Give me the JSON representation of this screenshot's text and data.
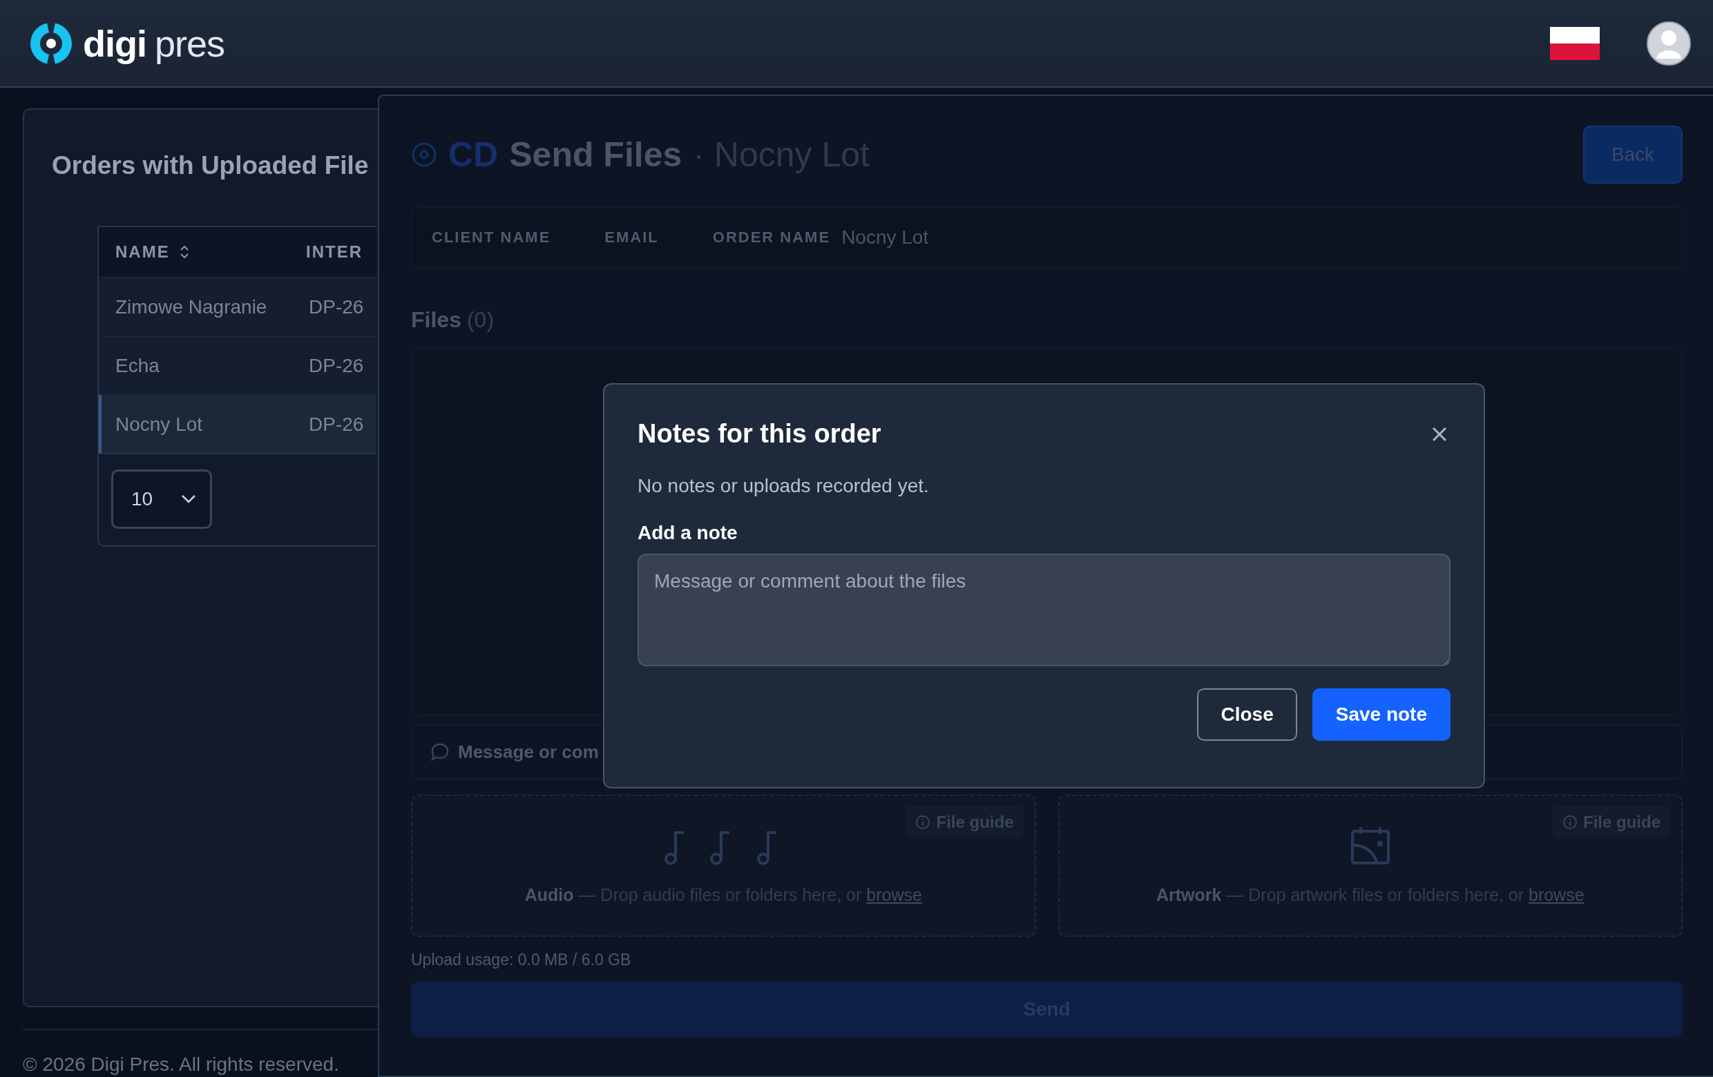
{
  "header": {
    "brand": "digi",
    "brand_suffix": "pres"
  },
  "orders_panel": {
    "title": "Orders with Uploaded File",
    "columns": [
      {
        "label": "NAME",
        "sortable": true
      },
      {
        "label": "INTER",
        "sortable": false
      }
    ],
    "rows": [
      {
        "cells": [
          "Zimowe Nagranie",
          "DP-26"
        ],
        "selected": false
      },
      {
        "cells": [
          "Echa",
          "DP-26"
        ],
        "selected": false
      },
      {
        "cells": [
          "Nocny Lot",
          "DP-26"
        ],
        "selected": true
      }
    ],
    "page_size": "10"
  },
  "footer": {
    "text": "© 2026 Digi Pres. All rights reserved."
  },
  "send_panel": {
    "format": "CD",
    "title": "Send Files",
    "subtitle": "· Nocny Lot",
    "back_button": "Back",
    "info": [
      {
        "label": "CLIENT NAME"
      },
      {
        "label": "EMAIL"
      },
      {
        "label": "ORDER NAME",
        "value": "Nocny Lot"
      }
    ],
    "files_label": "Files",
    "files_count": "(0)",
    "message_placeholder": "Message or com",
    "drop_zones": [
      {
        "kind": "audio",
        "text": "**Audio** — Drop audio files or folders here, or ",
        "link": "browse",
        "guide": "File guide"
      },
      {
        "kind": "artwork",
        "text": "**Artwork** — Drop artwork files or folders here, or ",
        "link": "browse",
        "guide": "File guide"
      }
    ],
    "usage": "Upload usage: 0.0 MB / 6.0 GB",
    "send_button": "Send"
  },
  "modal": {
    "title": "Notes for this order",
    "empty_text": "No notes or uploads recorded yet.",
    "field_label": "Add a note",
    "placeholder": "Message or comment about the files",
    "buttons": [
      {
        "label": "Close",
        "kind": "secondary"
      },
      {
        "label": "Save note",
        "kind": "primary"
      }
    ]
  }
}
